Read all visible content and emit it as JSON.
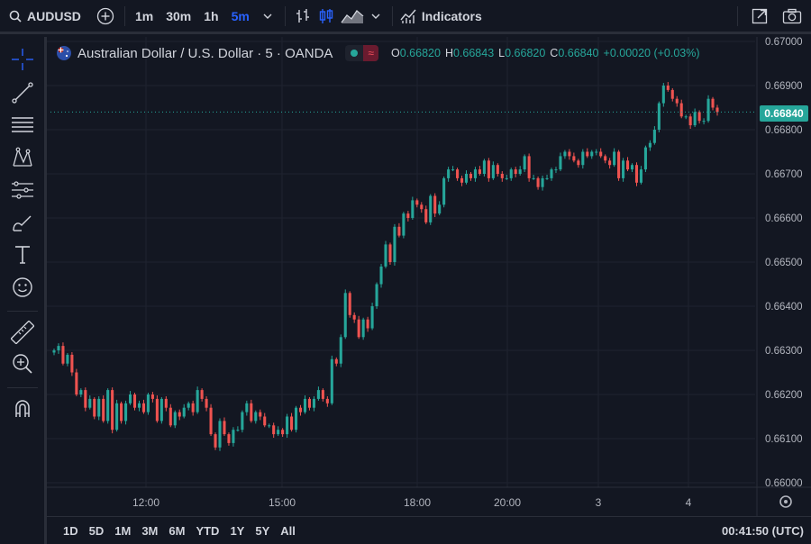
{
  "toolbar": {
    "symbol": "AUDUSD",
    "timeframes": [
      "1m",
      "30m",
      "1h",
      "5m"
    ],
    "active_timeframe": "5m",
    "indicators_label": "Indicators"
  },
  "legend": {
    "title": "Australian Dollar / U.S. Dollar · 5 · OANDA",
    "open_label": "O",
    "open": "0.66820",
    "high_label": "H",
    "high": "0.66843",
    "low_label": "L",
    "low": "0.66820",
    "close_label": "C",
    "close": "0.66840",
    "change": "+0.00020 (+0.03%)"
  },
  "last_price": "0.66840",
  "bottom": {
    "ranges": [
      "1D",
      "5D",
      "1M",
      "3M",
      "6M",
      "YTD",
      "1Y",
      "5Y",
      "All"
    ],
    "clock": "00:41:50 (UTC)"
  },
  "colors": {
    "up": "#26a69a",
    "down": "#ef5350",
    "background": "#131722",
    "grid": "#1f2330",
    "accent": "#2962ff"
  },
  "chart_data": {
    "type": "candlestick",
    "title": "Australian Dollar / U.S. Dollar · 5 · OANDA",
    "y_ticks": [
      "0.67000",
      "0.66900",
      "0.66800",
      "0.66700",
      "0.66600",
      "0.66500",
      "0.66400",
      "0.66300",
      "0.66200",
      "0.66100",
      "0.66000"
    ],
    "ylim": [
      0.65995,
      0.67005
    ],
    "x_ticks": [
      "12:00",
      "15:00",
      "18:00",
      "20:00",
      "3",
      "4"
    ],
    "series": [
      {
        "values": [
          0.663,
          0.6631,
          0.6627,
          0.6629,
          0.6625,
          0.662,
          0.6621,
          0.6617,
          0.6619,
          0.6615,
          0.6619,
          0.6614,
          0.6621,
          0.6612,
          0.6618,
          0.6614,
          0.6618,
          0.662,
          0.6617,
          0.6618,
          0.6616,
          0.662,
          0.6619,
          0.6614,
          0.6619,
          0.6617,
          0.6613,
          0.6616,
          0.6615,
          0.6617,
          0.6618,
          0.6616,
          0.6621,
          0.6619,
          0.6617,
          0.6611,
          0.6608,
          0.6614,
          0.6611,
          0.6609,
          0.6612,
          0.6612,
          0.6616,
          0.6618,
          0.6614,
          0.6616,
          0.6615,
          0.6613,
          0.6613,
          0.6611,
          0.6612,
          0.6611,
          0.6615,
          0.6612,
          0.6617,
          0.6616,
          0.6619,
          0.6617,
          0.6619,
          0.6621,
          0.6619,
          0.6618,
          0.6628,
          0.6627,
          0.6633,
          0.6643,
          0.6638,
          0.6637,
          0.6633,
          0.6637,
          0.6635,
          0.664,
          0.6645,
          0.6649,
          0.6654,
          0.665,
          0.6658,
          0.6656,
          0.6661,
          0.666,
          0.6664,
          0.6663,
          0.6662,
          0.6659,
          0.6665,
          0.6661,
          0.6663,
          0.6669,
          0.6671,
          0.6671,
          0.6669,
          0.6668,
          0.667,
          0.6669,
          0.6671,
          0.667,
          0.6673,
          0.6669,
          0.6672,
          0.667,
          0.6669,
          0.6669,
          0.6671,
          0.667,
          0.6671,
          0.6674,
          0.6669,
          0.6669,
          0.6667,
          0.6669,
          0.6669,
          0.6671,
          0.6671,
          0.6674,
          0.6675,
          0.6674,
          0.6673,
          0.6672,
          0.6675,
          0.6674,
          0.6675,
          0.6675,
          0.6674,
          0.6673,
          0.6672,
          0.6675,
          0.6669,
          0.6673,
          0.6671,
          0.6672,
          0.6668,
          0.6671,
          0.6676,
          0.6677,
          0.668,
          0.6686,
          0.669,
          0.6689,
          0.6687,
          0.6686,
          0.6683,
          0.6683,
          0.6681,
          0.6684,
          0.6682,
          0.6682,
          0.6687,
          0.6685,
          0.6684
        ]
      }
    ]
  }
}
